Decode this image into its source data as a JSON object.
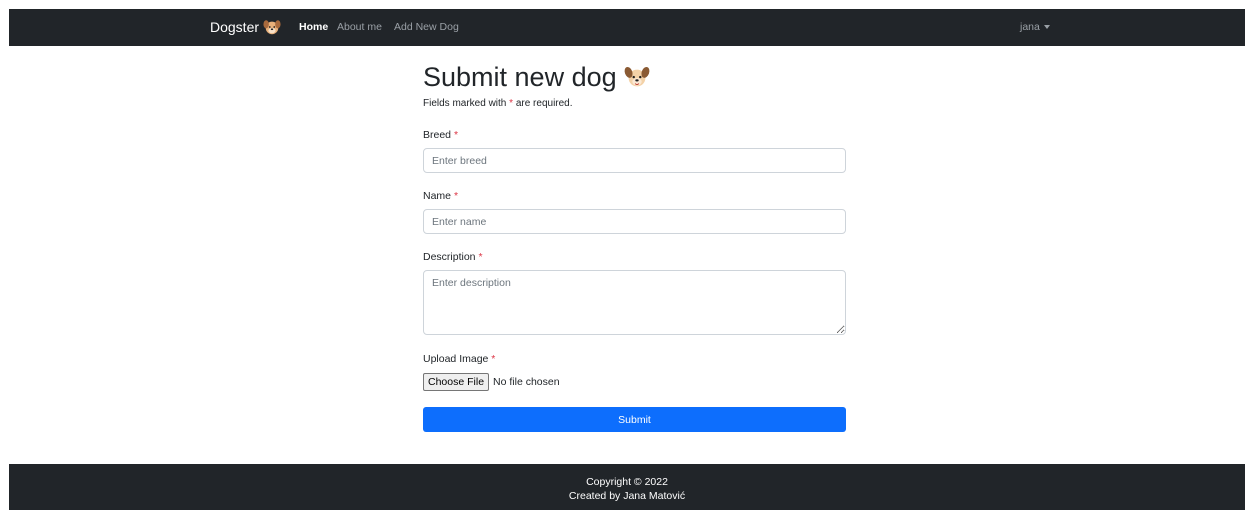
{
  "navbar": {
    "brand": "Dogster",
    "links": [
      "Home",
      "About me",
      "Add New Dog"
    ],
    "active_link": "Home",
    "user": "jana"
  },
  "form": {
    "title": "Submit new dog",
    "required_note_prefix": "Fields marked with ",
    "required_star": "*",
    "required_note_suffix": " are required.",
    "breed": {
      "label": "Breed",
      "placeholder": "Enter breed",
      "value": ""
    },
    "name": {
      "label": "Name",
      "placeholder": "Enter name",
      "value": ""
    },
    "description": {
      "label": "Description",
      "placeholder": "Enter description",
      "value": ""
    },
    "upload": {
      "label": "Upload Image",
      "button": "Choose File",
      "status": "No file chosen"
    },
    "submit": "Submit"
  },
  "footer": {
    "copyright": "Copyright © 2022",
    "created_by": "Created by Jana Matović"
  },
  "colors": {
    "navbar_bg": "#212529",
    "primary": "#0d6efd",
    "required": "#dc3545"
  },
  "icons": {
    "brand": "dog-face-icon",
    "title": "dog-icon",
    "user_menu": "caret-down-icon"
  }
}
